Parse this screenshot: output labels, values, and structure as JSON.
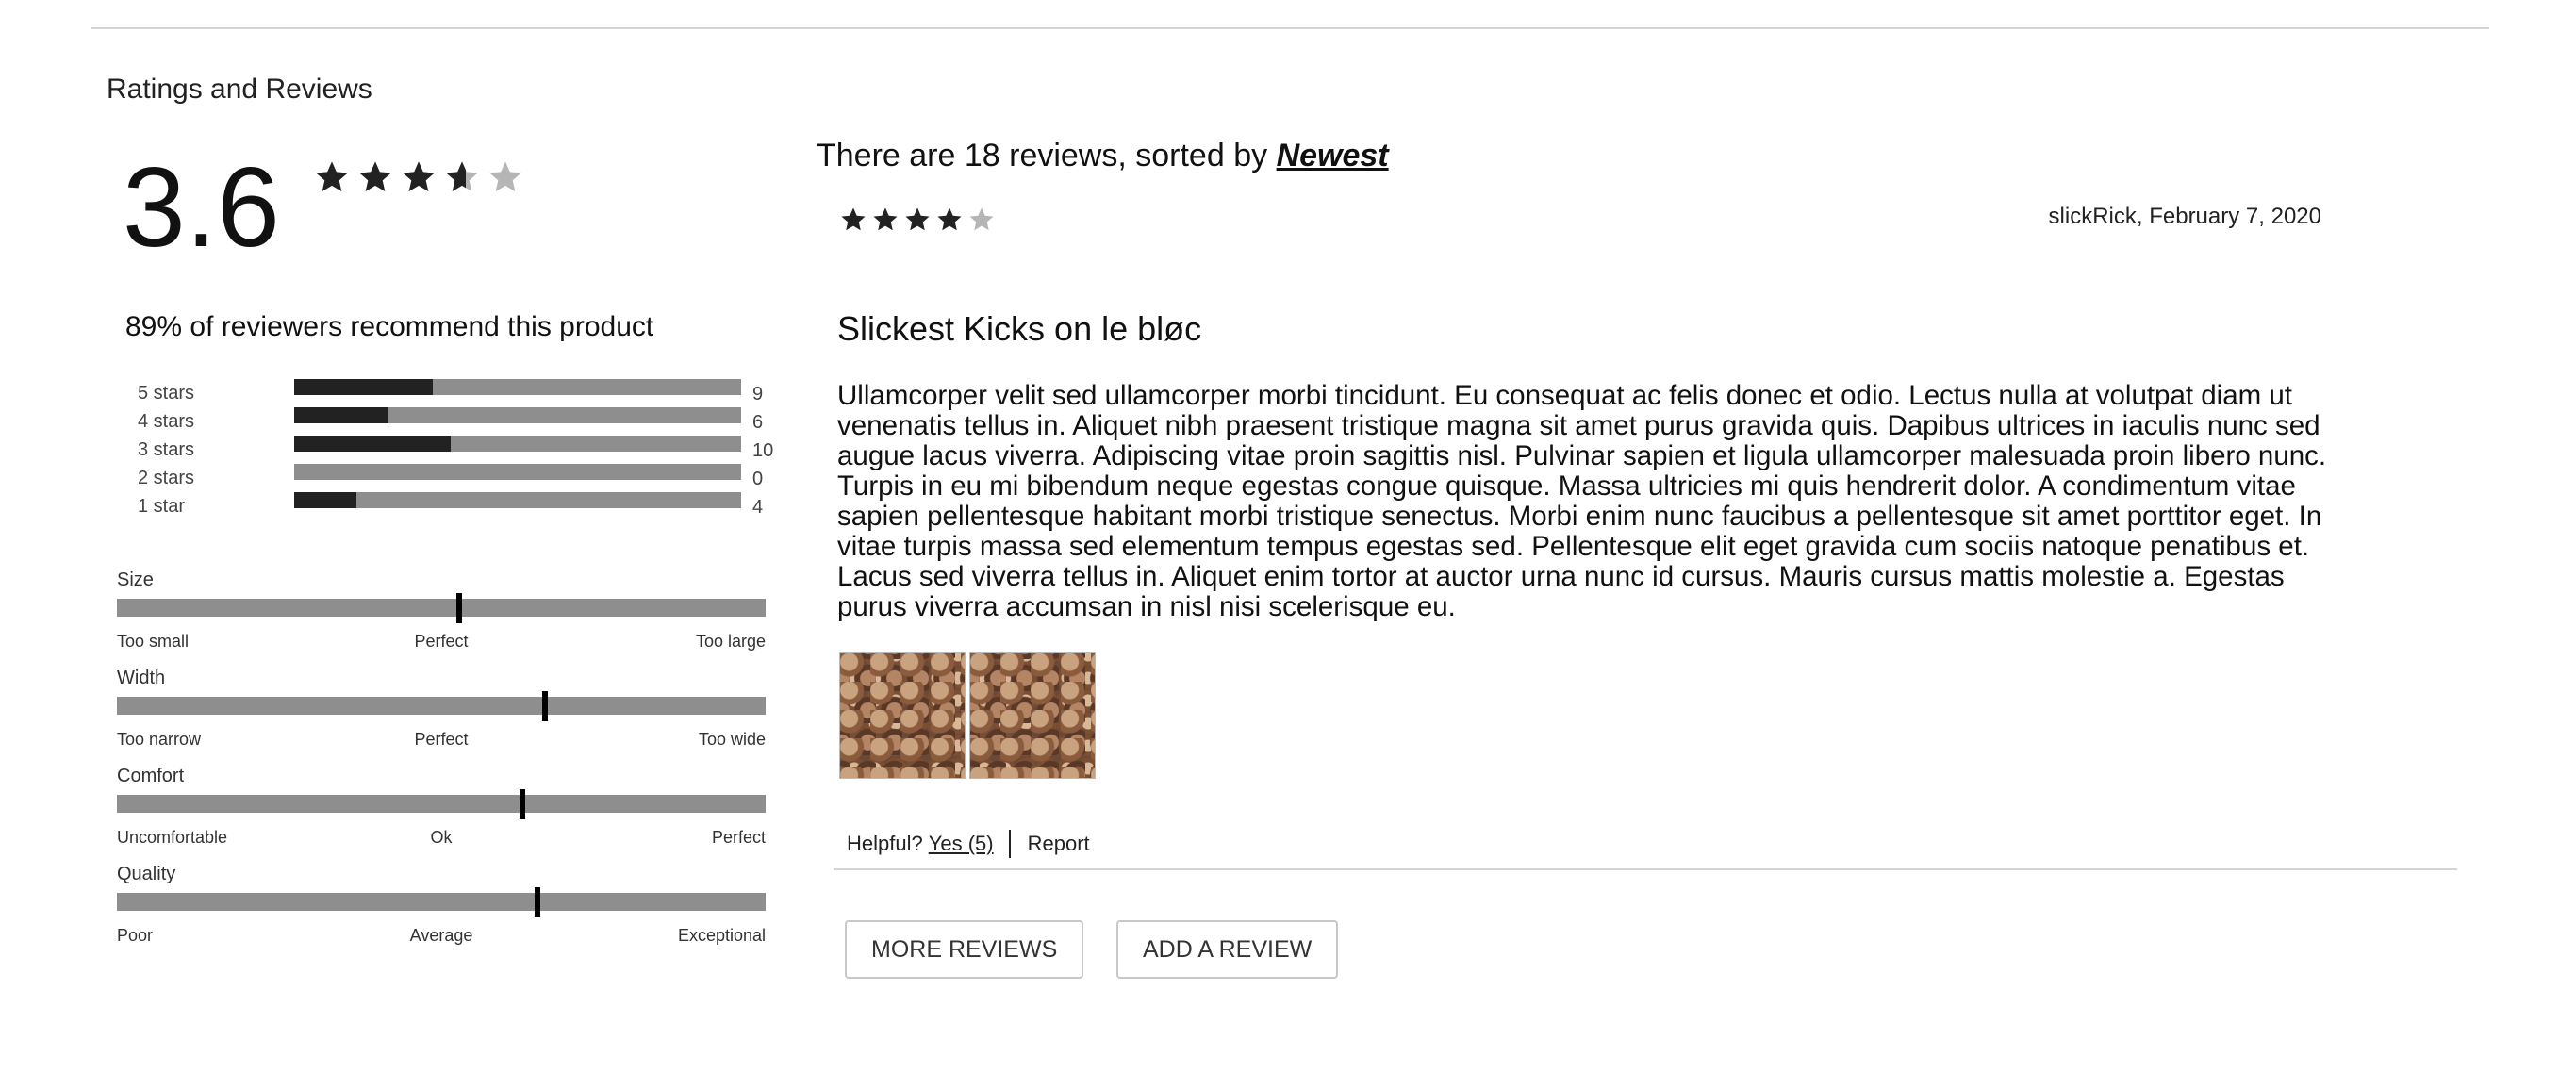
{
  "section_title": "Ratings and Reviews",
  "summary": {
    "average": "3.6",
    "average_value": 3.6,
    "max_stars": 5,
    "recommend_text": "89% of reviewers recommend this product"
  },
  "breakdown": [
    {
      "label": "5 stars",
      "count": "9",
      "fraction": 0.31
    },
    {
      "label": "4 stars",
      "count": "6",
      "fraction": 0.21
    },
    {
      "label": "3 stars",
      "count": "10",
      "fraction": 0.35
    },
    {
      "label": "2 stars",
      "count": "0",
      "fraction": 0.0
    },
    {
      "label": "1 star",
      "count": "4",
      "fraction": 0.14
    }
  ],
  "characteristics": [
    {
      "name": "Size",
      "low": "Too small",
      "mid": "Perfect",
      "high": "Too large",
      "value": 0.527
    },
    {
      "name": "Width",
      "low": "Too narrow",
      "mid": "Perfect",
      "high": "Too wide",
      "value": 0.66
    },
    {
      "name": "Comfort",
      "low": "Uncomfortable",
      "mid": "Ok",
      "high": "Perfect",
      "value": 0.625
    },
    {
      "name": "Quality",
      "low": "Poor",
      "mid": "Average",
      "high": "Exceptional",
      "value": 0.648
    }
  ],
  "list": {
    "sort_prefix": "There are 18 reviews, sorted by ",
    "sort_key": "Newest"
  },
  "review": {
    "rating": 4,
    "meta": "slickRick, February 7, 2020",
    "title": "Slickest Kicks on le bløc",
    "body": "Ullamcorper velit sed ullamcorper morbi tincidunt. Eu consequat ac felis donec et odio. Lectus nulla at volutpat diam ut venenatis tellus in. Aliquet nibh praesent tristique magna sit amet purus gravida quis. Dapibus ultrices in iaculis nunc sed augue lacus viverra. Adipiscing vitae proin sagittis nisl. Pulvinar sapien et ligula ullamcorper malesuada proin libero nunc. Turpis in eu mi bibendum neque egestas congue quisque. Massa ultricies mi quis hendrerit dolor. A condimentum vitae sapien pellentesque habitant morbi tristique senectus. Morbi enim nunc faucibus a pellentesque sit amet porttitor eget. In vitae turpis massa sed elementum tempus egestas sed. Pellentesque elit eget gravida cum sociis natoque penatibus et. Lacus sed viverra tellus in. Aliquet enim tortor at auctor urna nunc id cursus. Mauris cursus mattis molestie a. Egestas purus viverra accumsan in nisl nisi scelerisque eu.",
    "helpful_label": "Helpful?",
    "yes_label": "Yes (5)",
    "report_label": "Report"
  },
  "buttons": {
    "more": "MORE REVIEWS",
    "add": "ADD A REVIEW"
  },
  "colors": {
    "star_full": "#222222",
    "star_empty": "#b5b5b5",
    "bar_track": "#8e8e8e",
    "bar_fill": "#222222"
  }
}
